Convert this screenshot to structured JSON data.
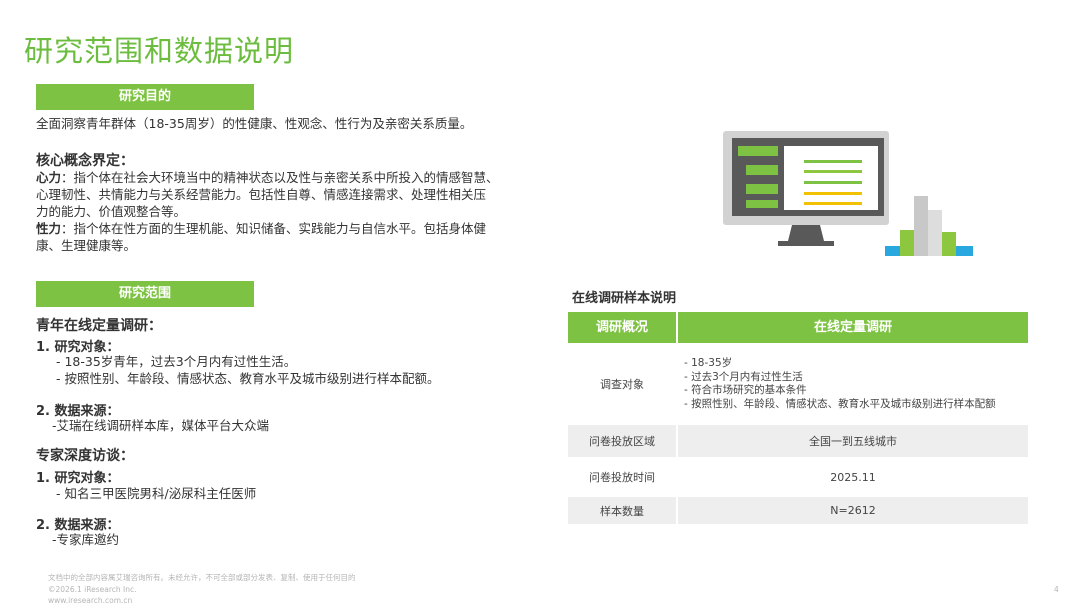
{
  "title": "研究范围和数据说明",
  "purpose": {
    "tag": "研究目的",
    "text": "全面洞察青年群体（18-35周岁）的性健康、性观念、性行为及亲密关系质量。"
  },
  "concepts": {
    "heading": "核心概念界定：",
    "xinli_term": "心力",
    "xinli_lines": [
      "：指个体在社会大环境当中的精神状态以及性与亲密关系中所投入的情感智慧、",
      "心理韧性、共情能力与关系经营能力。包括性自尊、情感连接需求、处理性相关压",
      "力的能力、价值观整合等。"
    ],
    "xingli_term": "性力",
    "xingli_lines": [
      "：指个体在性方面的生理机能、知识储备、实践能力与自信水平。包括身体健",
      "康、生理健康等。"
    ]
  },
  "scope": {
    "tag": "研究范围",
    "online": {
      "heading": "青年在线定量调研：",
      "obj_title": "1.  研究对象：",
      "obj_lines": [
        "- 18-35岁青年，过去3个月内有过性生活。",
        "- 按照性别、年龄段、情感状态、教育水平及城市级别进行样本配额。"
      ],
      "src_title": "2. 数据来源：",
      "src_line": "-艾瑞在线调研样本库，媒体平台大众端"
    },
    "expert": {
      "heading": "专家深度访谈：",
      "obj_title": "1.  研究对象：",
      "obj_line": "- 知名三甲医院男科/泌尿科主任医师",
      "src_title": "2. 数据来源：",
      "src_line": "-专家库邀约"
    }
  },
  "table": {
    "title": "在线调研样本说明",
    "col1": "调研概况",
    "col2": "在线定量调研",
    "rows": [
      {
        "label": "调查对象",
        "lines": [
          "- 18-35岁",
          "- 过去3个月内有过性生活",
          "- 符合市场研究的基本条件",
          "- 按照性别、年龄段、情感状态、教育水平及城市级别进行样本配额"
        ]
      },
      {
        "label": "问卷投放区域",
        "value": "全国一到五线城市"
      },
      {
        "label": "问卷投放时间",
        "value": "2025.11"
      },
      {
        "label": "样本数量",
        "value": "N=2612"
      }
    ]
  },
  "footer": {
    "line1": "文档中的全部内容属艾瑞咨询所有。未经允许，不可全部或部分发表、复制、使用于任何目的",
    "line2": "©2026.1 iResearch Inc.",
    "line3": "www.iresearch.com.cn",
    "page": "4"
  },
  "colors": {
    "brand_green": "#7dc242",
    "title_green": "#6cbd3f"
  },
  "illustration": {
    "icon": "computer-monitor-chart-icon"
  }
}
